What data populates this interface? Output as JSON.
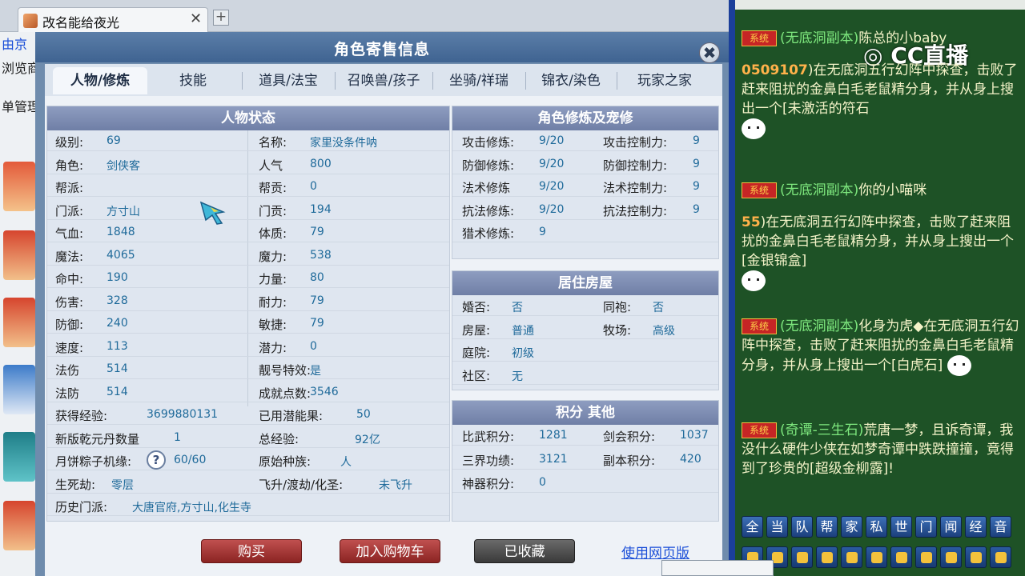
{
  "browser": {
    "tab_title": "改名能给夜光",
    "tab_close": "✕",
    "new_tab": "+"
  },
  "left_page": {
    "texts": [
      "由京",
      "浏览商",
      "单管理"
    ]
  },
  "window": {
    "title": "角色寄售信息",
    "close": "✖"
  },
  "tabs": [
    "人物/修炼",
    "技能",
    "道具/法宝",
    "召唤兽/孩子",
    "坐骑/祥瑞",
    "锦衣/染色",
    "玩家之家"
  ],
  "status_panel": {
    "title": "人物状态",
    "left": [
      {
        "label": "级别:",
        "value": "69"
      },
      {
        "label": "角色:",
        "value": "剑侠客"
      },
      {
        "label": "帮派:",
        "value": ""
      },
      {
        "label": "门派:",
        "value": "方寸山"
      },
      {
        "label": "气血:",
        "value": "1848"
      },
      {
        "label": "魔法:",
        "value": "4065"
      },
      {
        "label": "命中:",
        "value": "190"
      },
      {
        "label": "伤害:",
        "value": "328"
      },
      {
        "label": "防御:",
        "value": "240"
      },
      {
        "label": "速度:",
        "value": "113"
      },
      {
        "label": "法伤",
        "value": "514"
      },
      {
        "label": "法防",
        "value": "514"
      }
    ],
    "right": [
      {
        "label": "名称:",
        "value": "家里没条件呐"
      },
      {
        "label": "人气",
        "value": "800"
      },
      {
        "label": "帮贡:",
        "value": "0"
      },
      {
        "label": "门贡:",
        "value": "194"
      },
      {
        "label": "体质:",
        "value": "79"
      },
      {
        "label": "魔力:",
        "value": "538"
      },
      {
        "label": "力量:",
        "value": "80"
      },
      {
        "label": "耐力:",
        "value": "79"
      },
      {
        "label": "敏捷:",
        "value": "79"
      },
      {
        "label": "潜力:",
        "value": "0"
      },
      {
        "label": "靓号特效:",
        "value": "是"
      },
      {
        "label": "成就点数:",
        "value": "3546"
      }
    ],
    "extra": [
      {
        "label": "获得经验:",
        "value": "3699880131",
        "label2": "已用潜能果:",
        "value2": "50"
      },
      {
        "label": "新版乾元丹数量",
        "value": "1",
        "label2": "总经验:",
        "value2": "92亿"
      },
      {
        "label": "月饼粽子机缘:",
        "value": "60/60",
        "label2": "原始种族:",
        "value2": "人"
      },
      {
        "label": "生死劫:",
        "value": "零层",
        "label2": "飞升/渡劫/化圣:",
        "value2": "未飞升"
      },
      {
        "label": "历史门派:",
        "value": "大唐官府,方寸山,化生寺"
      }
    ],
    "help_icon": "?"
  },
  "cultivation_panel": {
    "title": "角色修炼及宠修",
    "rows": [
      {
        "label": "攻击修炼:",
        "value": "9/20",
        "label2": "攻击控制力:",
        "value2": "9"
      },
      {
        "label": "防御修炼:",
        "value": "9/20",
        "label2": "防御控制力:",
        "value2": "9"
      },
      {
        "label": "法术修炼",
        "value": "9/20",
        "label2": "法术控制力:",
        "value2": "9"
      },
      {
        "label": "抗法修炼:",
        "value": "9/20",
        "label2": "抗法控制力:",
        "value2": "9"
      },
      {
        "label": "猎术修炼:",
        "value": "9",
        "label2": "",
        "value2": ""
      }
    ]
  },
  "house_panel": {
    "title": "居住房屋",
    "rows": [
      {
        "label": "婚否:",
        "value": "否",
        "label2": "同袍:",
        "value2": "否"
      },
      {
        "label": "房屋:",
        "value": "普通",
        "label2": "牧场:",
        "value2": "高级"
      },
      {
        "label": "庭院:",
        "value": "初级",
        "label2": "",
        "value2": ""
      },
      {
        "label": "社区:",
        "value": "无",
        "label2": "",
        "value2": ""
      }
    ]
  },
  "score_panel": {
    "title": "积分 其他",
    "rows": [
      {
        "label": "比武积分:",
        "value": "1281",
        "label2": "剑会积分:",
        "value2": "1037"
      },
      {
        "label": "三界功绩:",
        "value": "3121",
        "label2": "副本积分:",
        "value2": "420"
      },
      {
        "label": "神器积分:",
        "value": "0",
        "label2": "",
        "value2": ""
      }
    ]
  },
  "actions": {
    "buy": "购买",
    "add_cart": "加入购物车",
    "collected": "已收藏",
    "web_version": "使用网页版"
  },
  "chat": {
    "logo": "CC直播",
    "badge": "系统",
    "messages": [
      {
        "chan": "(无底洞副本)",
        "digits": "",
        "text": "陈总的小baby",
        "tail": ""
      },
      {
        "chan": "",
        "digits": "0509107",
        "text": ")在无底洞五行幻阵中探查，击败了赶来阻扰的金鼻白毛老鼠精分身，并从身上搜出一个[未激活的符石",
        "tail": ""
      },
      {
        "chan": "(无底洞副本)",
        "digits": "",
        "text": "你的小喵咪",
        "tail": ""
      },
      {
        "chan": "",
        "digits": "55",
        "text": ")在无底洞五行幻阵中探查，击败了赶来阻扰的金鼻白毛老鼠精分身，并从身上搜出一个[金银锦盒]",
        "tail": ""
      },
      {
        "chan": "(无底洞副本)",
        "digits": "",
        "text": "化身为虎◆在无底洞五行幻阵中探查，击败了赶来阻扰的金鼻白毛老鼠精分身，并从身上搜出一个[白虎石]",
        "tail": ""
      },
      {
        "chan": "(奇谭-三生石)",
        "digits": "",
        "text": "荒唐一梦，且诉奇谭，我没什么硬件少侠在如梦奇谭中跌跌撞撞，竟得到了珍贵的[超级金柳露]",
        "tail": "!"
      }
    ],
    "toolbar": [
      "全",
      "当",
      "队",
      "帮",
      "家",
      "私",
      "世",
      "门",
      "闻",
      "经",
      "音"
    ]
  }
}
